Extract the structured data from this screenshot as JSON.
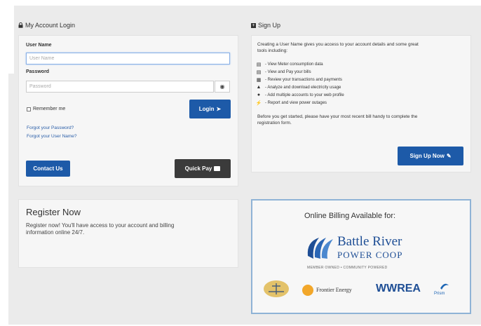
{
  "login": {
    "section_title": "My Account Login",
    "username_label": "User Name",
    "username_placeholder": "User Name",
    "password_label": "Password",
    "password_placeholder": "Password",
    "remember_label": "Remember me",
    "login_button": "Login",
    "forgot_password": "Forgot your Password?",
    "forgot_username": "Forgot your User Name?",
    "contact_button": "Contact Us",
    "quickpay_button": "Quick Pay"
  },
  "signup": {
    "section_title": "Sign Up",
    "intro_line1": "Creating a User Name gives you access to your account details and some great",
    "intro_line2": "tools including:",
    "features": [
      {
        "icon": "meter-icon",
        "text": "- View Meter consumption data"
      },
      {
        "icon": "bill-icon",
        "text": "- View and Pay your bills"
      },
      {
        "icon": "list-icon",
        "text": "- Review your transactions and payments"
      },
      {
        "icon": "chart-icon",
        "text": "- Analyze and download electricity usage"
      },
      {
        "icon": "user-icon",
        "text": "- Add multiple accounts to your web profile"
      },
      {
        "icon": "bolt-icon",
        "text": "- Report and view power outages"
      }
    ],
    "before_line1": "Before you get started, please have your most recent bill handy to complete the",
    "before_line2": "registration form.",
    "button": "Sign Up Now"
  },
  "register": {
    "title": "Register Now",
    "text_line1": "Register now! You'll have access to your account and billing",
    "text_line2": "information online 24/7."
  },
  "billing": {
    "title": "Online Billing Available for:",
    "brand_line1": "Battle River",
    "brand_line2": "POWER COOP",
    "tagline": "MEMBER OWNED • COMMUNITY POWERED",
    "partners": [
      "Frontier Energy",
      "WWREA",
      "Prism"
    ]
  },
  "colors": {
    "primary_blue": "#1d5aa8",
    "dark_button": "#3b3b3b",
    "brand_blue": "#1e4e95"
  }
}
